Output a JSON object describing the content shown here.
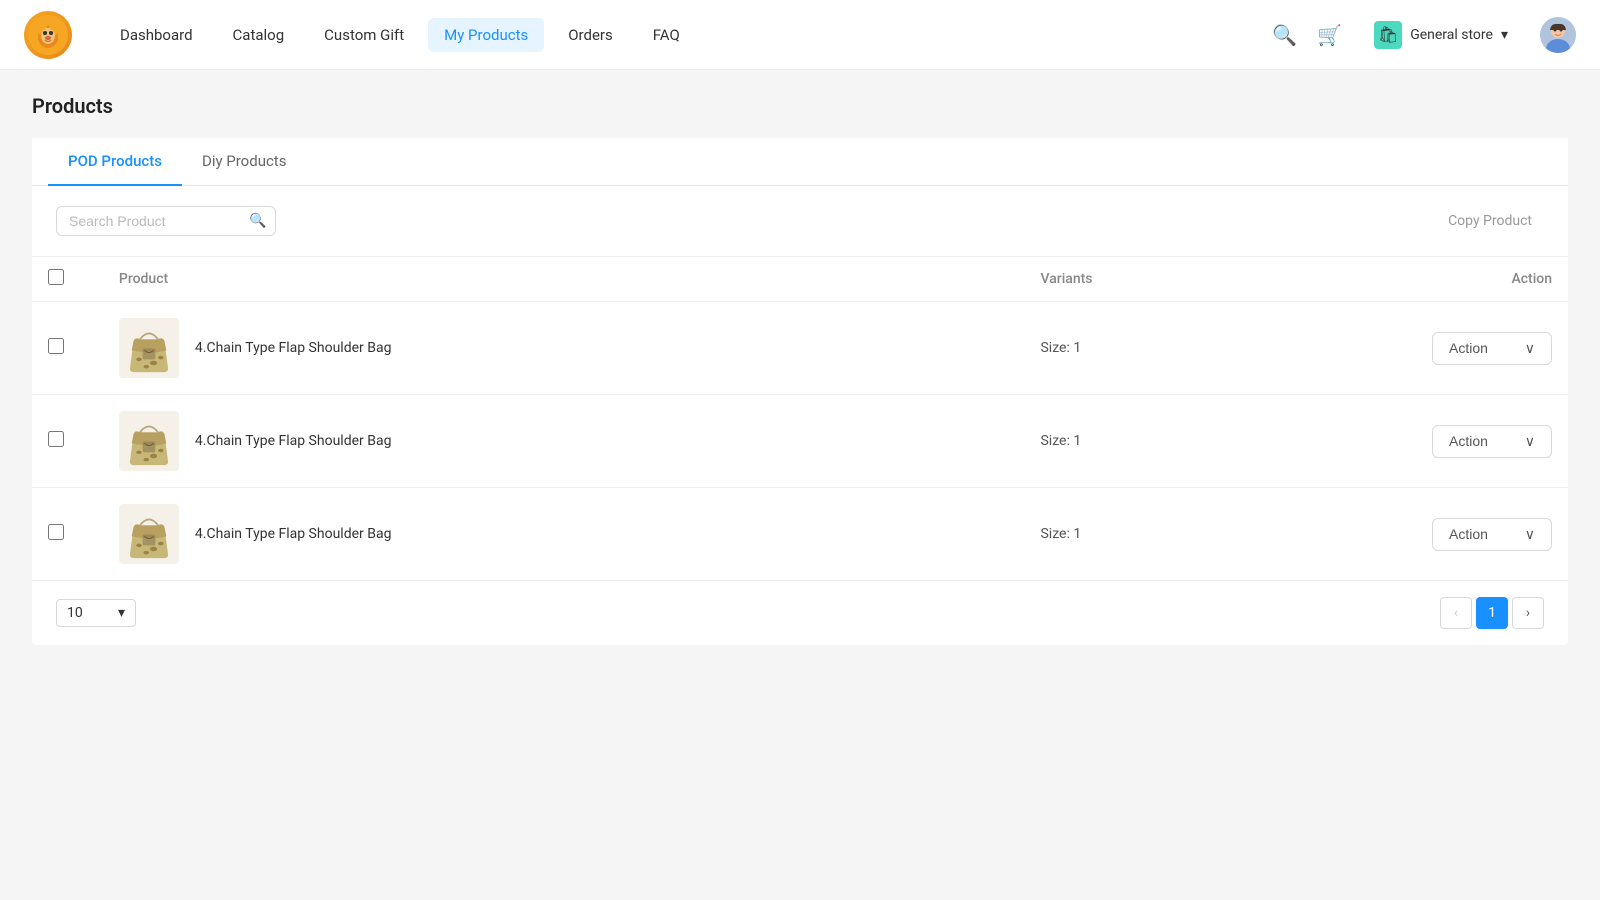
{
  "header": {
    "logo_emoji": "🐕",
    "nav_items": [
      {
        "label": "Dashboard",
        "active": false
      },
      {
        "label": "Catalog",
        "active": false
      },
      {
        "label": "Custom Gift",
        "active": false
      },
      {
        "label": "My Products",
        "active": true
      },
      {
        "label": "Orders",
        "active": false
      },
      {
        "label": "FAQ",
        "active": false
      }
    ],
    "store_label": "General store",
    "store_emoji": "🛍",
    "avatar_emoji": "👤"
  },
  "page": {
    "title": "Products"
  },
  "tabs": [
    {
      "label": "POD Products",
      "active": true
    },
    {
      "label": "Diy Products",
      "active": false
    }
  ],
  "toolbar": {
    "search_placeholder": "Search Product",
    "copy_product_label": "Copy Product"
  },
  "table": {
    "columns": [
      "",
      "Product",
      "Variants",
      "Action"
    ],
    "rows": [
      {
        "product_name": "4.Chain Type Flap Shoulder Bag",
        "variants": "Size:  1",
        "action_label": "Action"
      },
      {
        "product_name": "4.Chain Type Flap Shoulder Bag",
        "variants": "Size:  1",
        "action_label": "Action"
      },
      {
        "product_name": "4.Chain Type Flap Shoulder Bag",
        "variants": "Size:  1",
        "action_label": "Action"
      }
    ]
  },
  "pagination": {
    "page_size": "10",
    "current_page": 1,
    "prev_label": "‹",
    "next_label": "›"
  }
}
